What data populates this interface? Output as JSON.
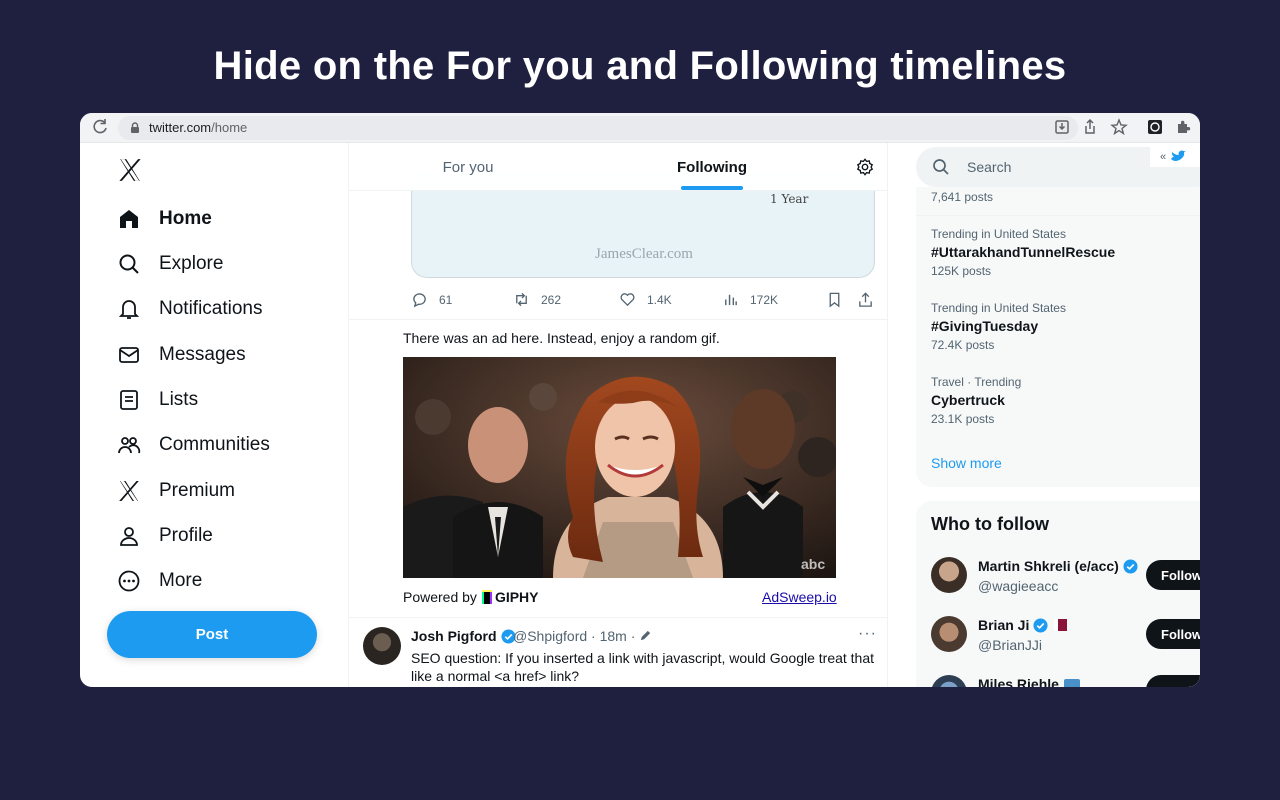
{
  "headline": "Hide on the For you and Following timelines",
  "browser": {
    "url_host": "twitter.com",
    "url_path": "/home"
  },
  "sidebar": {
    "items": [
      {
        "label": "Home",
        "icon": "home-icon"
      },
      {
        "label": "Explore",
        "icon": "search-icon"
      },
      {
        "label": "Notifications",
        "icon": "bell-icon"
      },
      {
        "label": "Messages",
        "icon": "envelope-icon"
      },
      {
        "label": "Lists",
        "icon": "list-icon"
      },
      {
        "label": "Communities",
        "icon": "people-icon"
      },
      {
        "label": "Premium",
        "icon": "x-logo-icon"
      },
      {
        "label": "Profile",
        "icon": "person-icon"
      },
      {
        "label": "More",
        "icon": "more-circle-icon"
      }
    ],
    "post_label": "Post"
  },
  "timeline": {
    "tabs": [
      "For you",
      "Following"
    ],
    "active_tab": "Following",
    "card": {
      "period_label": "1 Year",
      "brand": "JamesClear.com"
    },
    "actions": {
      "replies": "61",
      "reposts": "262",
      "likes": "1.4K",
      "views": "172K"
    },
    "ad_replacement": {
      "note": "There was an ad here. Instead, enjoy a random gif.",
      "powered_by": "Powered by",
      "giphy": "GIPHY",
      "link": "AdSweep.io",
      "watermark": "abc"
    },
    "tweet": {
      "name": "Josh Pigford",
      "handle_time": "@Shpigford · 18m ·",
      "text": "SEO question: If you inserted a link with javascript, would Google treat that like a normal <a href> link?",
      "more": "···"
    }
  },
  "right": {
    "search_placeholder": "Search",
    "ext_popup": "«",
    "trend_top_count": "7,641 posts",
    "trends": [
      {
        "context": "Trending in United States",
        "title": "#UttarakhandTunnelRescue",
        "count": "125K posts"
      },
      {
        "context": "Trending in United States",
        "title": "#GivingTuesday",
        "count": "72.4K posts"
      },
      {
        "context": "Travel · Trending",
        "title": "Cybertruck",
        "count": "23.1K posts"
      }
    ],
    "show_more": "Show more",
    "who_to_follow": {
      "title": "Who to follow",
      "users": [
        {
          "name": "Martin Shkreli (e/acc)",
          "handle": "@wagieeacc",
          "button": "Follow"
        },
        {
          "name": "Brian Ji",
          "handle": "@BrianJJi",
          "button": "Follow"
        },
        {
          "name": "Miles Riehle",
          "handle": "",
          "button": ""
        }
      ]
    }
  },
  "colors": {
    "background": "#1f1f3f",
    "accent": "#1d9bf0",
    "text": "#0f1419",
    "muted": "#536471"
  }
}
